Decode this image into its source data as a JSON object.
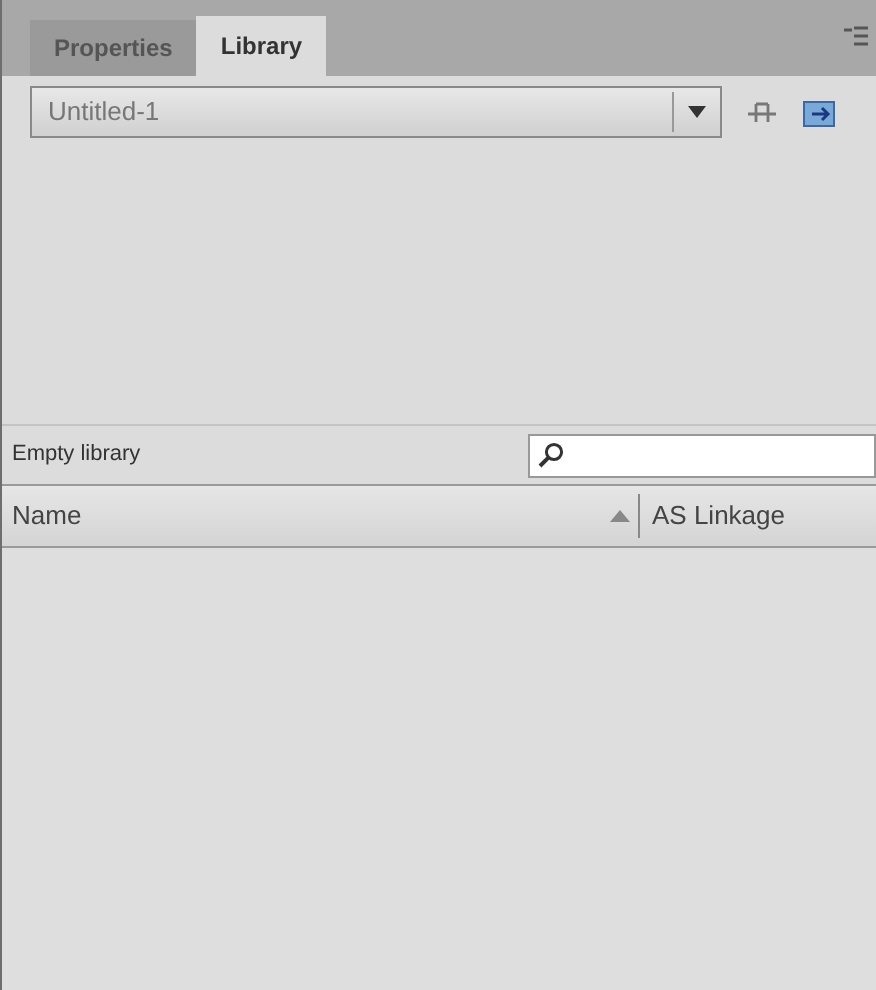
{
  "tabs": [
    {
      "label": "Properties",
      "selected": false
    },
    {
      "label": "Library",
      "selected": true
    }
  ],
  "document_select": {
    "value": "Untitled-1"
  },
  "status": "Empty library",
  "table": {
    "columns": [
      {
        "label": "Name"
      },
      {
        "label": "AS Linkage"
      }
    ]
  }
}
